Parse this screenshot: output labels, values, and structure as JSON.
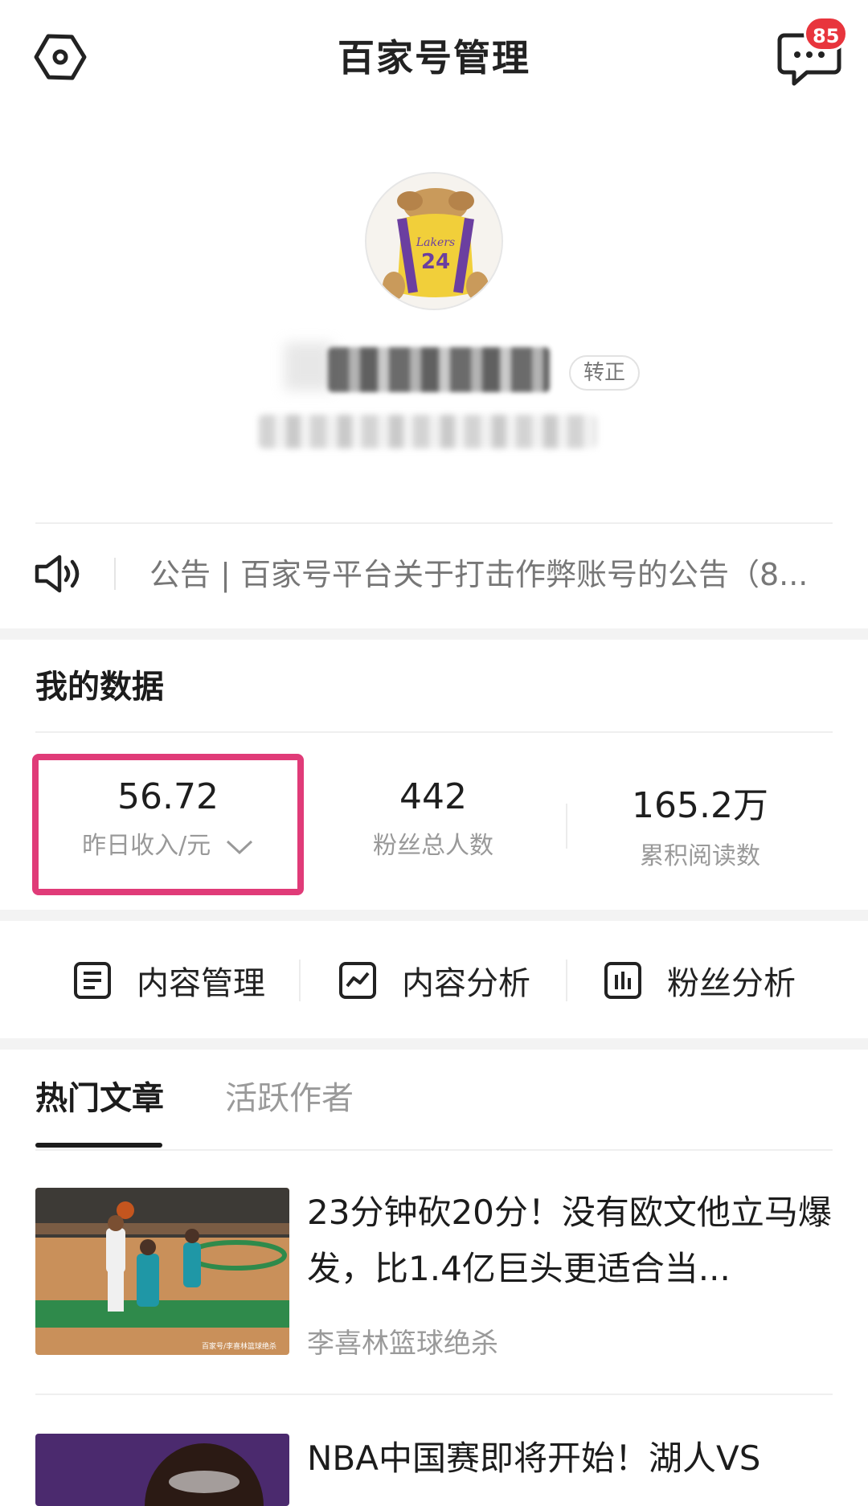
{
  "header": {
    "title": "百家号管理",
    "message_badge": "85"
  },
  "profile": {
    "tag": "转正"
  },
  "notice": {
    "text": "公告 | 百家号平台关于打击作弊账号的公告（8..."
  },
  "my_data": {
    "title": "我的数据",
    "stats": [
      {
        "value": "56.72",
        "label": "昨日收入/元"
      },
      {
        "value": "442",
        "label": "粉丝总人数"
      },
      {
        "value": "165.2万",
        "label": "累积阅读数"
      }
    ]
  },
  "quick_actions": [
    {
      "label": "内容管理",
      "icon": "document-list-icon"
    },
    {
      "label": "内容分析",
      "icon": "line-chart-icon"
    },
    {
      "label": "粉丝分析",
      "icon": "bar-chart-icon"
    }
  ],
  "tabs": [
    {
      "label": "热门文章",
      "active": true
    },
    {
      "label": "活跃作者",
      "active": false
    }
  ],
  "articles": [
    {
      "title": "23分钟砍20分！没有欧文他立马爆发，比1.4亿巨头更适合当...",
      "source": "李喜林篮球绝杀",
      "thumb_caption": "百家号/李喜林篮球绝杀"
    },
    {
      "title": "NBA中国赛即将开始！湖人VS",
      "source": ""
    }
  ],
  "colors": {
    "highlight": "#e03b78",
    "badge": "#e8353d"
  }
}
